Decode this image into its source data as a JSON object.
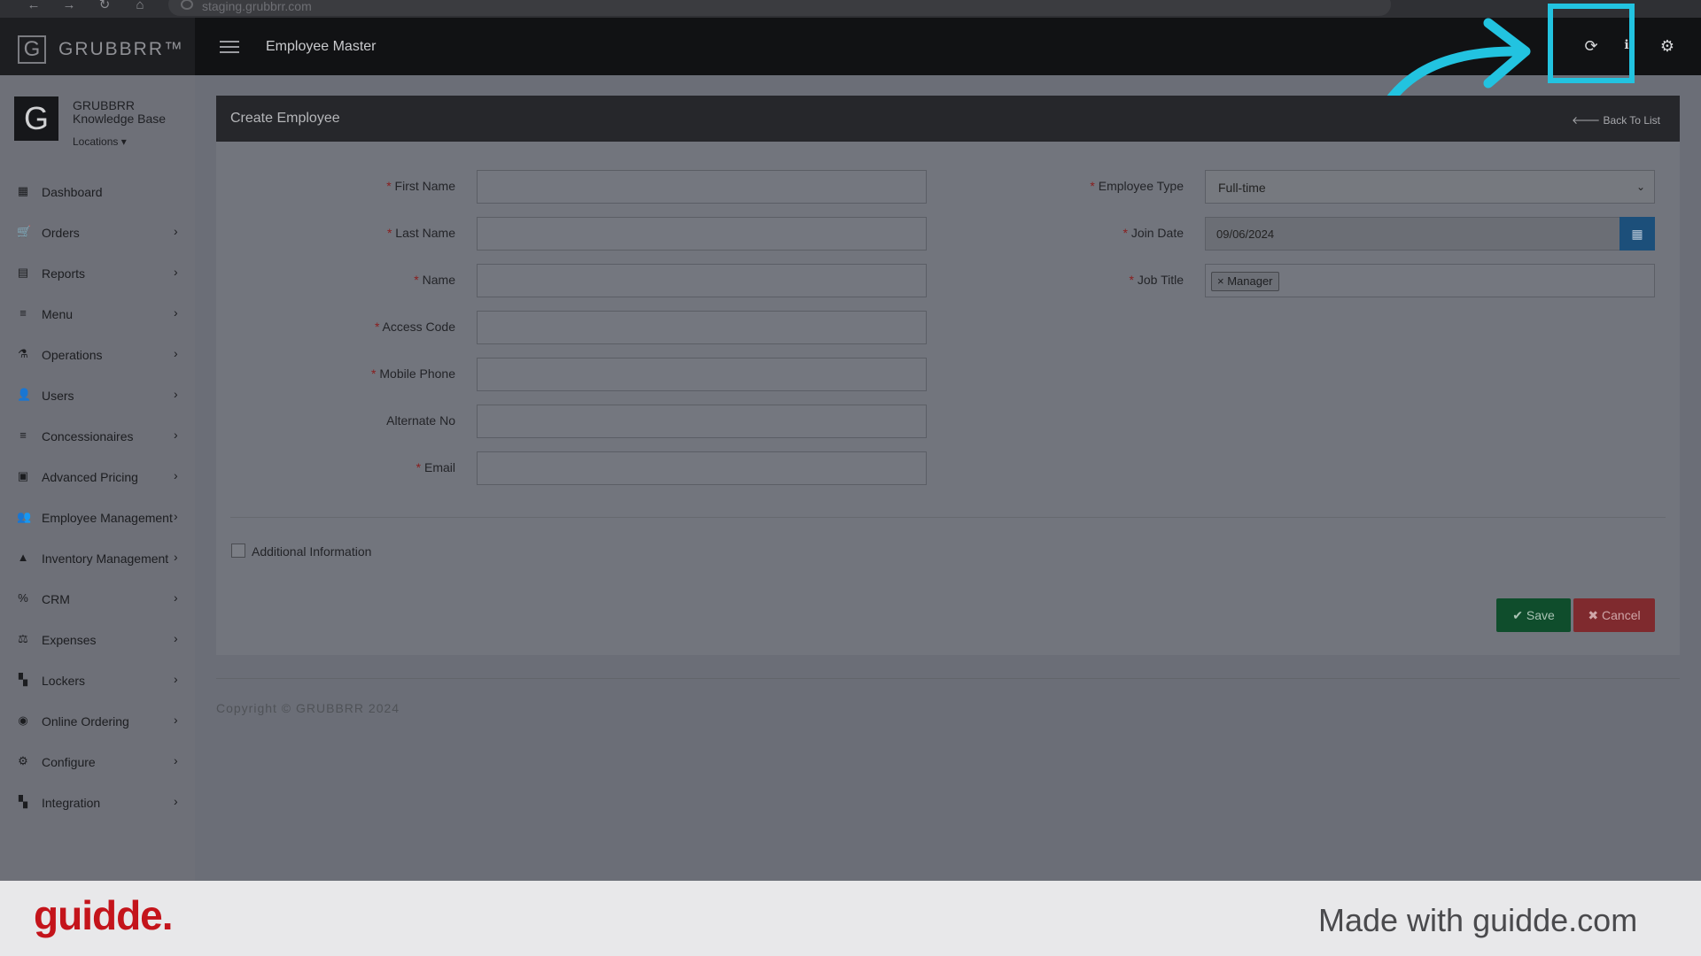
{
  "browser": {
    "url": "staging.grubbrr.com",
    "back_icon": "←",
    "forward_icon": "→",
    "reload_icon": "↻",
    "home_icon": "⌂"
  },
  "app": {
    "logo_letter": "G",
    "brand": "GRUBBRR™",
    "page_title": "Employee Master",
    "top_icons": {
      "refresh": "⟳",
      "info": "ℹ",
      "settings": "⚙"
    }
  },
  "sidebar": {
    "profile": {
      "avatar_letter": "G",
      "name": "GRUBBRR Knowledge Base",
      "locations": "Locations ▾"
    },
    "items": [
      {
        "label": "Dashboard",
        "icon": "▦",
        "chevron": ""
      },
      {
        "label": "Orders",
        "icon": "🛒",
        "chevron": "›"
      },
      {
        "label": "Reports",
        "icon": "▤",
        "chevron": "›"
      },
      {
        "label": "Menu",
        "icon": "≡",
        "chevron": "›"
      },
      {
        "label": "Operations",
        "icon": "⚗",
        "chevron": "›"
      },
      {
        "label": "Users",
        "icon": "👤",
        "chevron": "›"
      },
      {
        "label": "Concessionaires",
        "icon": "≡",
        "chevron": "›"
      },
      {
        "label": "Advanced Pricing",
        "icon": "▣",
        "chevron": "›"
      },
      {
        "label": "Employee Management",
        "icon": "👥",
        "chevron": "›"
      },
      {
        "label": "Inventory Management",
        "icon": "▲",
        "chevron": "›"
      },
      {
        "label": "CRM",
        "icon": "%",
        "chevron": "›"
      },
      {
        "label": "Expenses",
        "icon": "⚖",
        "chevron": "›"
      },
      {
        "label": "Lockers",
        "icon": "▚",
        "chevron": "›"
      },
      {
        "label": "Online Ordering",
        "icon": "◉",
        "chevron": "›"
      },
      {
        "label": "Configure",
        "icon": "⚙",
        "chevron": "›"
      },
      {
        "label": "Integration",
        "icon": "▚",
        "chevron": "›"
      }
    ]
  },
  "panel": {
    "title": "Create Employee",
    "back_link": "🡐 Back To List",
    "fields_left": [
      {
        "label": "First Name",
        "required": true,
        "value": ""
      },
      {
        "label": "Last Name",
        "required": true,
        "value": ""
      },
      {
        "label": "Name",
        "required": true,
        "value": ""
      },
      {
        "label": "Access Code",
        "required": true,
        "value": ""
      },
      {
        "label": "Mobile Phone",
        "required": true,
        "value": ""
      },
      {
        "label": "Alternate No",
        "required": false,
        "value": ""
      },
      {
        "label": "Email",
        "required": true,
        "value": ""
      }
    ],
    "employee_type": {
      "label": "Employee Type",
      "value": "Full-time",
      "caret": "⌄"
    },
    "join_date": {
      "label": "Join Date",
      "value": "09/06/2024",
      "icon": "▦"
    },
    "job_title": {
      "label": "Job Title",
      "tag": "× Manager"
    },
    "required_mark": "* ",
    "additional_info": "Additional Information",
    "save": "✔ Save",
    "cancel": "✖ Cancel"
  },
  "footer": {
    "copyright": "Copyright © GRUBBRR 2024"
  },
  "banner": {
    "logo": "guidde.",
    "text": "Made with guidde.com"
  },
  "colors": {
    "highlight": "#22c3e0",
    "save": "#0f4d2c",
    "cancel": "#7f2a2e",
    "guidde_red": "#c4141b"
  }
}
